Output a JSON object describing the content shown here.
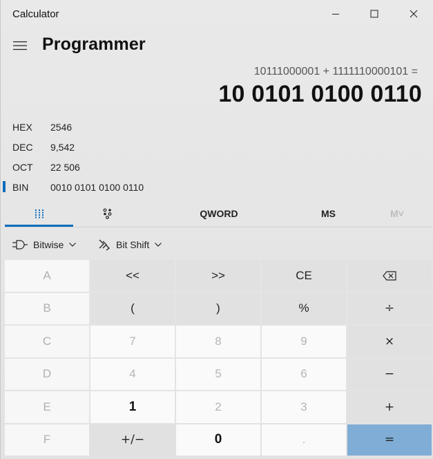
{
  "window": {
    "title": "Calculator",
    "colors": {
      "accent": "#0b6cbd",
      "equals_bg": "#7fadd6"
    }
  },
  "header": {
    "mode_title": "Programmer"
  },
  "display": {
    "expression": "10111000001 + 1111110000101 =",
    "result": "10 0101 0100 0110"
  },
  "radix": [
    {
      "label": "HEX",
      "value": "2546",
      "selected": false
    },
    {
      "label": "DEC",
      "value": "9,542",
      "selected": false
    },
    {
      "label": "OCT",
      "value": "22 506",
      "selected": false
    },
    {
      "label": "BIN",
      "value": "0010 0101 0100 0110",
      "selected": true
    }
  ],
  "tabs": {
    "keypad_icon": "keypad-grid-icon",
    "bitflip_icon": "bit-toggle-icon",
    "word_size": "QWORD",
    "ms": "MS",
    "mlist": "M˅"
  },
  "dropdowns": {
    "bitwise": "Bitwise",
    "bitshift": "Bit Shift"
  },
  "keys": {
    "row1": [
      "A",
      "<<",
      ">>",
      "CE",
      "⌫"
    ],
    "row2": [
      "B",
      "(",
      ")",
      "%",
      "÷"
    ],
    "row3": [
      "C",
      "7",
      "8",
      "9",
      "×"
    ],
    "row4": [
      "D",
      "4",
      "5",
      "6",
      "−"
    ],
    "row5": [
      "E",
      "1",
      "2",
      "3",
      "+"
    ],
    "row6": [
      "F",
      "+/−",
      "0",
      ".",
      "="
    ]
  }
}
